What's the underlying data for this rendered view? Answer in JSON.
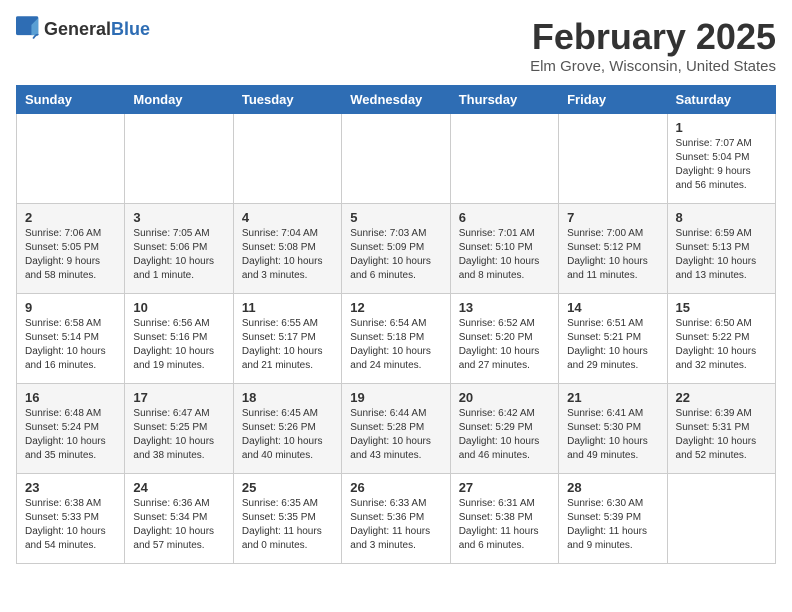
{
  "header": {
    "logo_general": "General",
    "logo_blue": "Blue",
    "month_title": "February 2025",
    "location": "Elm Grove, Wisconsin, United States"
  },
  "days_of_week": [
    "Sunday",
    "Monday",
    "Tuesday",
    "Wednesday",
    "Thursday",
    "Friday",
    "Saturday"
  ],
  "weeks": [
    [
      {
        "day": "",
        "info": ""
      },
      {
        "day": "",
        "info": ""
      },
      {
        "day": "",
        "info": ""
      },
      {
        "day": "",
        "info": ""
      },
      {
        "day": "",
        "info": ""
      },
      {
        "day": "",
        "info": ""
      },
      {
        "day": "1",
        "info": "Sunrise: 7:07 AM\nSunset: 5:04 PM\nDaylight: 9 hours and 56 minutes."
      }
    ],
    [
      {
        "day": "2",
        "info": "Sunrise: 7:06 AM\nSunset: 5:05 PM\nDaylight: 9 hours and 58 minutes."
      },
      {
        "day": "3",
        "info": "Sunrise: 7:05 AM\nSunset: 5:06 PM\nDaylight: 10 hours and 1 minute."
      },
      {
        "day": "4",
        "info": "Sunrise: 7:04 AM\nSunset: 5:08 PM\nDaylight: 10 hours and 3 minutes."
      },
      {
        "day": "5",
        "info": "Sunrise: 7:03 AM\nSunset: 5:09 PM\nDaylight: 10 hours and 6 minutes."
      },
      {
        "day": "6",
        "info": "Sunrise: 7:01 AM\nSunset: 5:10 PM\nDaylight: 10 hours and 8 minutes."
      },
      {
        "day": "7",
        "info": "Sunrise: 7:00 AM\nSunset: 5:12 PM\nDaylight: 10 hours and 11 minutes."
      },
      {
        "day": "8",
        "info": "Sunrise: 6:59 AM\nSunset: 5:13 PM\nDaylight: 10 hours and 13 minutes."
      }
    ],
    [
      {
        "day": "9",
        "info": "Sunrise: 6:58 AM\nSunset: 5:14 PM\nDaylight: 10 hours and 16 minutes."
      },
      {
        "day": "10",
        "info": "Sunrise: 6:56 AM\nSunset: 5:16 PM\nDaylight: 10 hours and 19 minutes."
      },
      {
        "day": "11",
        "info": "Sunrise: 6:55 AM\nSunset: 5:17 PM\nDaylight: 10 hours and 21 minutes."
      },
      {
        "day": "12",
        "info": "Sunrise: 6:54 AM\nSunset: 5:18 PM\nDaylight: 10 hours and 24 minutes."
      },
      {
        "day": "13",
        "info": "Sunrise: 6:52 AM\nSunset: 5:20 PM\nDaylight: 10 hours and 27 minutes."
      },
      {
        "day": "14",
        "info": "Sunrise: 6:51 AM\nSunset: 5:21 PM\nDaylight: 10 hours and 29 minutes."
      },
      {
        "day": "15",
        "info": "Sunrise: 6:50 AM\nSunset: 5:22 PM\nDaylight: 10 hours and 32 minutes."
      }
    ],
    [
      {
        "day": "16",
        "info": "Sunrise: 6:48 AM\nSunset: 5:24 PM\nDaylight: 10 hours and 35 minutes."
      },
      {
        "day": "17",
        "info": "Sunrise: 6:47 AM\nSunset: 5:25 PM\nDaylight: 10 hours and 38 minutes."
      },
      {
        "day": "18",
        "info": "Sunrise: 6:45 AM\nSunset: 5:26 PM\nDaylight: 10 hours and 40 minutes."
      },
      {
        "day": "19",
        "info": "Sunrise: 6:44 AM\nSunset: 5:28 PM\nDaylight: 10 hours and 43 minutes."
      },
      {
        "day": "20",
        "info": "Sunrise: 6:42 AM\nSunset: 5:29 PM\nDaylight: 10 hours and 46 minutes."
      },
      {
        "day": "21",
        "info": "Sunrise: 6:41 AM\nSunset: 5:30 PM\nDaylight: 10 hours and 49 minutes."
      },
      {
        "day": "22",
        "info": "Sunrise: 6:39 AM\nSunset: 5:31 PM\nDaylight: 10 hours and 52 minutes."
      }
    ],
    [
      {
        "day": "23",
        "info": "Sunrise: 6:38 AM\nSunset: 5:33 PM\nDaylight: 10 hours and 54 minutes."
      },
      {
        "day": "24",
        "info": "Sunrise: 6:36 AM\nSunset: 5:34 PM\nDaylight: 10 hours and 57 minutes."
      },
      {
        "day": "25",
        "info": "Sunrise: 6:35 AM\nSunset: 5:35 PM\nDaylight: 11 hours and 0 minutes."
      },
      {
        "day": "26",
        "info": "Sunrise: 6:33 AM\nSunset: 5:36 PM\nDaylight: 11 hours and 3 minutes."
      },
      {
        "day": "27",
        "info": "Sunrise: 6:31 AM\nSunset: 5:38 PM\nDaylight: 11 hours and 6 minutes."
      },
      {
        "day": "28",
        "info": "Sunrise: 6:30 AM\nSunset: 5:39 PM\nDaylight: 11 hours and 9 minutes."
      },
      {
        "day": "",
        "info": ""
      }
    ]
  ]
}
